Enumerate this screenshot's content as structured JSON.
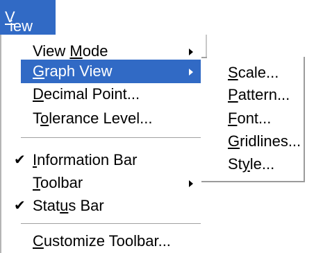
{
  "menubar": {
    "view_label_pre": "",
    "view_label_mn": "V",
    "view_label_post": "iew"
  },
  "menu": {
    "items": [
      {
        "pre": "View ",
        "mn": "M",
        "post": "ode",
        "check": "",
        "submenu": true
      },
      {
        "pre": "",
        "mn": "G",
        "post": "raph View",
        "check": "",
        "submenu": true,
        "selected": true
      },
      {
        "pre": "",
        "mn": "D",
        "post": "ecimal Point...",
        "check": "",
        "submenu": false
      },
      {
        "pre": "T",
        "mn": "o",
        "post": "lerance Level...",
        "check": "",
        "submenu": false
      },
      {
        "pre": "",
        "mn": "I",
        "post": "nformation Bar",
        "check": "✔",
        "submenu": false
      },
      {
        "pre": "",
        "mn": "T",
        "post": "oolbar",
        "check": "",
        "submenu": true
      },
      {
        "pre": "Stat",
        "mn": "u",
        "post": "s Bar",
        "check": "✔",
        "submenu": false
      },
      {
        "pre": "",
        "mn": "C",
        "post": "ustomize Toolbar...",
        "check": "",
        "submenu": false
      }
    ]
  },
  "submenu": {
    "items": [
      {
        "pre": "",
        "mn": "S",
        "post": "cale..."
      },
      {
        "pre": "",
        "mn": "P",
        "post": "attern..."
      },
      {
        "pre": "",
        "mn": "F",
        "post": "ont..."
      },
      {
        "pre": "",
        "mn": "G",
        "post": "ridlines..."
      },
      {
        "pre": "St",
        "mn": "y",
        "post": "le..."
      }
    ]
  },
  "colors": {
    "highlight": "#316ac5",
    "highlight_text": "#ffffff"
  }
}
